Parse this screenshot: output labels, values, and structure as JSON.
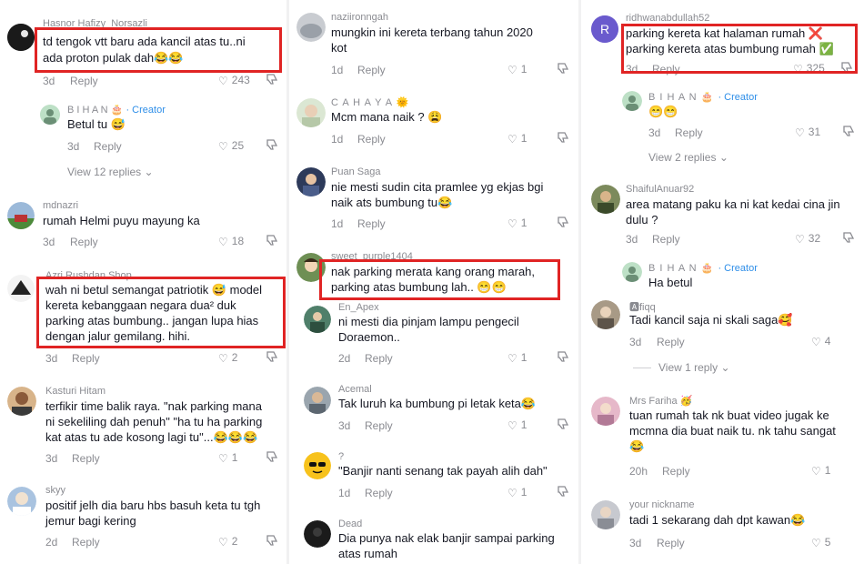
{
  "col1": {
    "comments": [
      {
        "user": "Hasnor Hafizy_Norsazli",
        "text": [
          "td tengok vtt baru ada kancil atas tu..ni",
          "ada proton pulak dah😂😂"
        ],
        "time": "3d",
        "reply": "Reply",
        "likes": "243"
      },
      {
        "user": "B I H A N",
        "badge": "· Creator",
        "text": [
          "Betul tu 😅"
        ],
        "time": "3d",
        "reply": "Reply",
        "likes": "25"
      },
      {
        "view_replies": "View 12 replies"
      },
      {
        "user": "mdnazri",
        "text": [
          "rumah Helmi puyu mayung ka"
        ],
        "time": "3d",
        "reply": "Reply",
        "likes": "18"
      },
      {
        "user": "Azri Rushdan Shop",
        "text": [
          "wah ni betul semangat patriotik 😅 model",
          "kereta kebanggaan negara dua² duk",
          "parking atas bumbung.. jangan lupa hias",
          "dengan jalur gemilang. hihi."
        ],
        "time": "3d",
        "reply": "Reply",
        "likes": "2"
      },
      {
        "user": "Kasturi Hitam",
        "text": [
          "terfikir time balik raya. \"nak parking mana",
          "ni sekeliling dah penuh\" \"ha tu ha parking",
          "kat atas tu ade kosong lagi tu\"...😂😂😂"
        ],
        "time": "3d",
        "reply": "Reply",
        "likes": "1"
      },
      {
        "user": "skyy",
        "text": [
          "positif jelh dia baru hbs basuh keta tu tgh",
          "jemur bagi kering"
        ],
        "time": "2d",
        "reply": "Reply",
        "likes": "2"
      }
    ]
  },
  "col2": {
    "comments": [
      {
        "user": "naziironngah",
        "text": [
          "mungkin ini kereta terbang tahun 2020",
          "kot"
        ],
        "time": "1d",
        "reply": "Reply",
        "likes": "1"
      },
      {
        "user": "C A H A Y A 🌞",
        "text": [
          "Mcm mana naik ? 😩"
        ],
        "time": "1d",
        "reply": "Reply",
        "likes": "1"
      },
      {
        "user": "Puan Saga",
        "text": [
          "nie mesti sudin cita pramlee yg ekjas bgi",
          "naik ats bumbung tu😂"
        ],
        "time": "1d",
        "reply": "Reply",
        "likes": "1"
      },
      {
        "user": "sweet_purple1404",
        "text": [
          "nak parking merata kang orang marah,",
          "parking atas bumbung lah.. 😁😁"
        ],
        "time": "",
        "reply": "",
        "likes": ""
      },
      {
        "user": "En_Apex",
        "text": [
          "ni mesti dia pinjam lampu pengecil",
          "Doraemon.."
        ],
        "time": "2d",
        "reply": "Reply",
        "likes": "1"
      },
      {
        "user": "Acemal",
        "text": [
          "Tak luruh ka bumbung pi letak keta😂"
        ],
        "time": "3d",
        "reply": "Reply",
        "likes": "1"
      },
      {
        "user": "?",
        "text": [
          "\"Banjir nanti senang tak payah alih dah\""
        ],
        "time": "1d",
        "reply": "Reply",
        "likes": "1"
      },
      {
        "user": "Dead",
        "text": [
          "Dia punya nak elak banjir sampai parking",
          "atas rumah"
        ],
        "time": "",
        "reply": "",
        "likes": ""
      }
    ]
  },
  "col3": {
    "comments": [
      {
        "user": "ridhwanabdullah52",
        "avatar_letter": "R",
        "text": [
          "parking kereta kat halaman rumah ❌",
          "parking kereta atas bumbung rumah ✅"
        ],
        "time": "3d",
        "reply": "Reply",
        "likes": "325"
      },
      {
        "user": "B I H A N",
        "badge": "· Creator",
        "text": [
          "😁😁"
        ],
        "time": "3d",
        "reply": "Reply",
        "likes": "31"
      },
      {
        "view_replies": "View 2 replies"
      },
      {
        "user": "ShaifulAnuar92",
        "text": [
          "area matang paku ka ni kat kedai cina jin",
          "dulu ?"
        ],
        "time": "3d",
        "reply": "Reply",
        "likes": "32"
      },
      {
        "user": "B I H A N",
        "badge": "· Creator",
        "text": [
          "Ha betul"
        ],
        "time": "",
        "reply": "",
        "likes": ""
      },
      {
        "user": "🅰fiqq",
        "text": [
          "Tadi kancil saja ni skali saga🥰"
        ],
        "time": "3d",
        "reply": "Reply",
        "likes": "4"
      },
      {
        "view_replies": "View 1 reply"
      },
      {
        "user": "Mrs Fariha 🥳",
        "text": [
          "tuan rumah tak nk buat video jugak ke",
          "mcmna dia buat naik tu. nk tahu sangat",
          "😂"
        ],
        "time": "20h",
        "reply": "Reply",
        "likes": "1"
      },
      {
        "user": "your nickname",
        "text": [
          "tadi 1 sekarang dah dpt kawan😂"
        ],
        "time": "3d",
        "reply": "Reply",
        "likes": "5"
      }
    ]
  },
  "colors": {
    "highlight": "#e02424",
    "creator": "#2e8ee8",
    "muted": "#8a8b91",
    "avatar_r": "#6a5acd"
  }
}
